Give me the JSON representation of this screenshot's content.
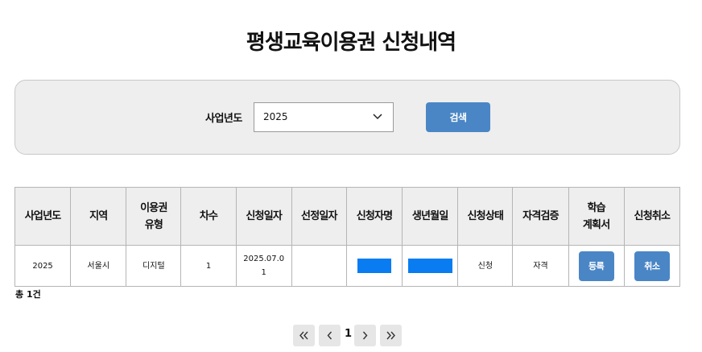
{
  "page": {
    "title": "평생교육이용권 신청내역"
  },
  "search": {
    "label": "사업년도",
    "selected_year": "2025",
    "button_label": "검색"
  },
  "table": {
    "headers": [
      "사업년도",
      "지역",
      "이용권\n유형",
      "차수",
      "신청일자",
      "선정일자",
      "신청자명",
      "생년월일",
      "신청상태",
      "자격검증",
      "학습\n계획서",
      "신청취소"
    ],
    "rows": [
      {
        "year": "2025",
        "region": "서울시",
        "voucher_type": "디지털",
        "round": "1",
        "apply_date": "2025.07.01",
        "selection_date": "",
        "status": "신청",
        "eligibility": "자격",
        "plan_button": "등록",
        "cancel_button": "취소"
      }
    ]
  },
  "summary": {
    "total": "총 1건"
  },
  "pagination": {
    "current_page": "1"
  },
  "colors": {
    "accent": "#4a86c5",
    "mask": "#0a7cf2",
    "panel": "#eeeeee"
  }
}
